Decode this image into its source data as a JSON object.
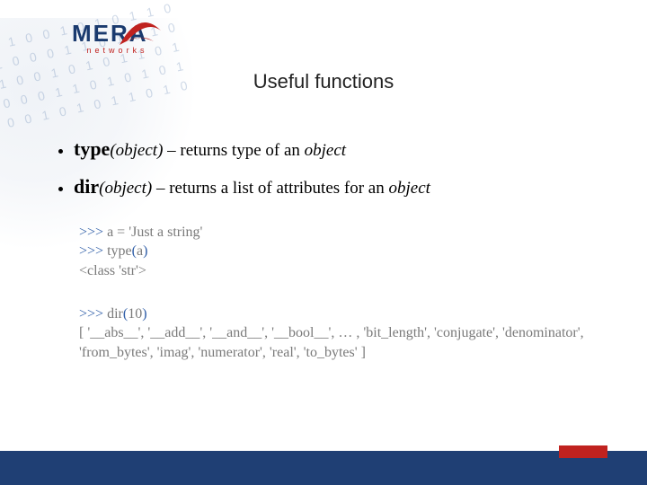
{
  "logo": {
    "main": "MERA",
    "sub": "networks"
  },
  "title": "Useful functions",
  "bullets": [
    {
      "fn": "type",
      "args": "(object)",
      "desc_prefix": " – returns type of an ",
      "desc_em": "object"
    },
    {
      "fn": "dir",
      "args": "(object)",
      "desc_prefix": " – returns a list of attributes for an ",
      "desc_em": "object"
    }
  ],
  "code": {
    "block1": {
      "p1": ">>>",
      "l1_rest": " a = 'Just a string'",
      "p2": ">>>",
      "l2_fn": " type",
      "l2_paren_open": "(",
      "l2_arg": "a",
      "l2_paren_close": ")",
      "out1": "<class 'str'>"
    },
    "block2": {
      "p1": ">>>",
      "l1_fn": " dir",
      "l1_paren_open": "(",
      "l1_arg": "10",
      "l1_paren_close": ")",
      "out1": "[  '__abs__', '__add__', '__and__', '__bool__', … , 'bit_length', 'conjugate', 'denominator', 'from_bytes', 'imag', 'numerator', 'real', 'to_bytes' ]"
    }
  }
}
